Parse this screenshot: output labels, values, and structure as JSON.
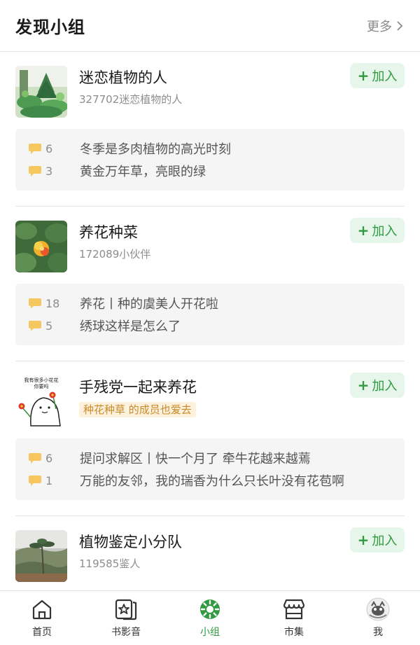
{
  "header": {
    "title": "发现小组",
    "more": "更多"
  },
  "groups": [
    {
      "name": "迷恋植物的人",
      "sub": "327702迷恋植物的人",
      "join": "加入",
      "topics": [
        {
          "count": "6",
          "title": "冬季是多肉植物的高光时刻"
        },
        {
          "count": "3",
          "title": "黄金万年草，亮眼的绿"
        }
      ]
    },
    {
      "name": "养花种菜",
      "sub": "172089小伙伴",
      "join": "加入",
      "topics": [
        {
          "count": "18",
          "title": "养花丨种的虞美人开花啦"
        },
        {
          "count": "5",
          "title": "绣球这样是怎么了"
        }
      ]
    },
    {
      "name": "手残党一起来养花",
      "tag": "种花种草 的成员也爱去",
      "thumb_text_1": "我有很多小花花",
      "thumb_text_2": "你要吗",
      "join": "加入",
      "topics": [
        {
          "count": "6",
          "title": "提问求解区丨快一个月了 牵牛花越来越蔫"
        },
        {
          "count": "1",
          "title": "万能的友邻，我的瑞香为什么只长叶没有花苞啊"
        }
      ]
    },
    {
      "name": "植物鉴定小分队",
      "sub": "119585鉴人",
      "join": "加入"
    }
  ],
  "tabbar": [
    {
      "label": "首页",
      "icon": "home-icon"
    },
    {
      "label": "书影音",
      "icon": "media-icon"
    },
    {
      "label": "小组",
      "icon": "group-icon",
      "active": true
    },
    {
      "label": "市集",
      "icon": "market-icon"
    },
    {
      "label": "我",
      "icon": "avatar-icon"
    }
  ],
  "colors": {
    "accent": "#2f9a3f",
    "join_bg": "#e7f6ea",
    "bubble": "#f6c760",
    "tag_text": "#c88a2a",
    "tag_bg": "#fdf1db"
  }
}
